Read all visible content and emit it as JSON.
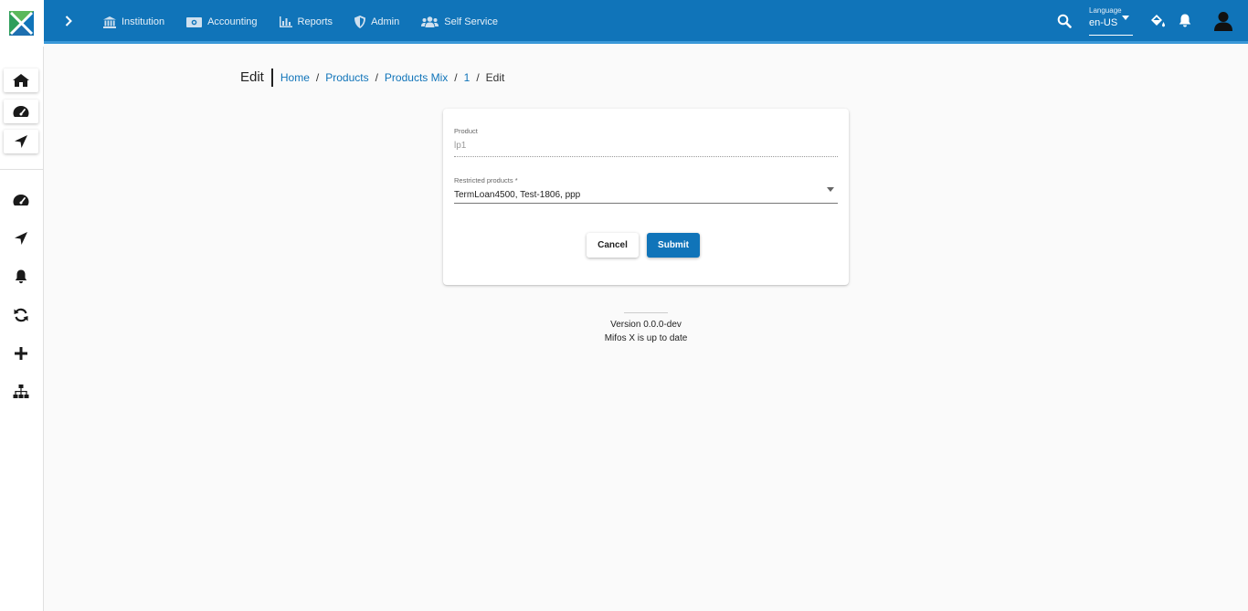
{
  "header": {
    "nav": [
      {
        "label": "Institution",
        "icon": "institution-icon"
      },
      {
        "label": "Accounting",
        "icon": "money-icon"
      },
      {
        "label": "Reports",
        "icon": "chart-icon"
      },
      {
        "label": "Admin",
        "icon": "shield-icon"
      },
      {
        "label": "Self Service",
        "icon": "users-icon"
      }
    ],
    "language": {
      "label": "Language",
      "value": "en-US"
    }
  },
  "sidebar": {
    "top_buttons": [
      "home-icon",
      "dashboard-icon",
      "navigation-icon"
    ],
    "items": [
      "dashboard-icon",
      "navigation-icon",
      "bell-icon",
      "refresh-icon",
      "plus-icon",
      "sitemap-icon"
    ]
  },
  "breadcrumb": {
    "title": "Edit",
    "links": [
      "Home",
      "Products",
      "Products Mix",
      "1"
    ],
    "current": "Edit",
    "separator": "/"
  },
  "form": {
    "product": {
      "label": "Product",
      "value": "lp1"
    },
    "restricted": {
      "label": "Restricted products *",
      "value": "TermLoan4500, Test-1806, ppp"
    },
    "cancel_label": "Cancel",
    "submit_label": "Submit"
  },
  "footer": {
    "version": "Version 0.0.0-dev",
    "status": "Mifos X is up to date"
  },
  "colors": {
    "primary": "#1074b9",
    "accent": "#3a98d8"
  }
}
